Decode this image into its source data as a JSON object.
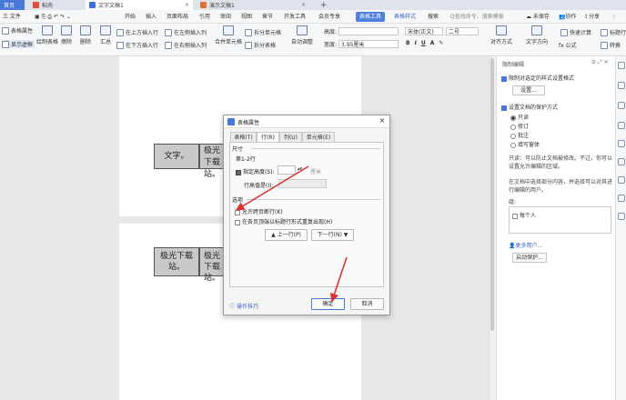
{
  "tabs": [
    {
      "label": "首页"
    },
    {
      "label": "稻壳"
    },
    {
      "label": "文字文稿1"
    },
    {
      "label": "演示文稿1"
    }
  ],
  "new_tab": "+",
  "menu": {
    "file": "三 文件",
    "items": [
      "开始",
      "插入",
      "页面布局",
      "引用",
      "审阅",
      "视图",
      "章节",
      "开发工具",
      "会员专享"
    ],
    "context": "表格工具",
    "style_tab": "表格样式",
    "search": "搜索",
    "search_placeholder": "Q查找命令、搜索模板",
    "unsync": "未保存",
    "collab": "协作",
    "share": "分享"
  },
  "ribbon": {
    "table_props": "表格属性",
    "show_gridlines": "显示虚框",
    "draw_table": "绘制表格",
    "erase": "擦除",
    "delete": "删除",
    "summary": "汇总",
    "insert_above": "在上方插入行",
    "insert_below": "在下方插入行",
    "insert_left": "在左侧插入列",
    "insert_right": "在右侧插入列",
    "merge": "合并单元格",
    "split_cell": "拆分单元格",
    "split_table": "拆分表格",
    "auto_fit": "自动调整",
    "height_label": "高度:",
    "height_val": "",
    "width_label": "宽度:",
    "width_val": "3.95厘米",
    "font": "宋体(正文)",
    "font_size": "二号",
    "align": "对齐方式",
    "text_dir": "文字方向",
    "formula": "fx 公式",
    "quick_calc": "快速计算",
    "title_repeat": "标题行",
    "convert": "转换"
  },
  "doc": {
    "cell1": "文字。",
    "cell2": "极光下载站。",
    "cell3": "极光下载站。",
    "cell4": "极光下载站。"
  },
  "panel": {
    "title": "限制编辑",
    "opt1": "限制对选定的样式设置格式",
    "settings_btn": "设置...",
    "opt2": "设置文档的保护方式",
    "radio1": "只读",
    "radio2": "修订",
    "radio3": "批注",
    "radio4": "填写窗体",
    "desc1": "只读：可以防止文档被修改。不过，你可以设置允许编辑的区域。",
    "desc2": "在文档中选择部分内容，并选择可以对其进行编辑的用户。",
    "group_label": "组:",
    "everyone": "每个人",
    "more_users": "更多用户...",
    "start_btn": "启动保护..."
  },
  "dialog": {
    "title": "表格属性",
    "tabs": [
      "表格(T)",
      "行(R)",
      "列(U)",
      "单元格(E)"
    ],
    "section_size": "尺寸",
    "row_info": "第1-2行",
    "height_check": "指定高度(S):",
    "height_unit": "厘米",
    "row_height_label": "行高值是(I):",
    "section_options": "选项",
    "allow_break": "允许跨页断行(K)",
    "repeat_header": "在各页顶端以标题行形式重复出现(H)",
    "prev_row": "▲ 上一行(P)",
    "next_row": "下一行(N) ▼",
    "tips": "操作技巧",
    "ok": "确定",
    "cancel": "取消"
  },
  "colors": {
    "accent": "#4a78d8",
    "arrow": "#d93434"
  }
}
